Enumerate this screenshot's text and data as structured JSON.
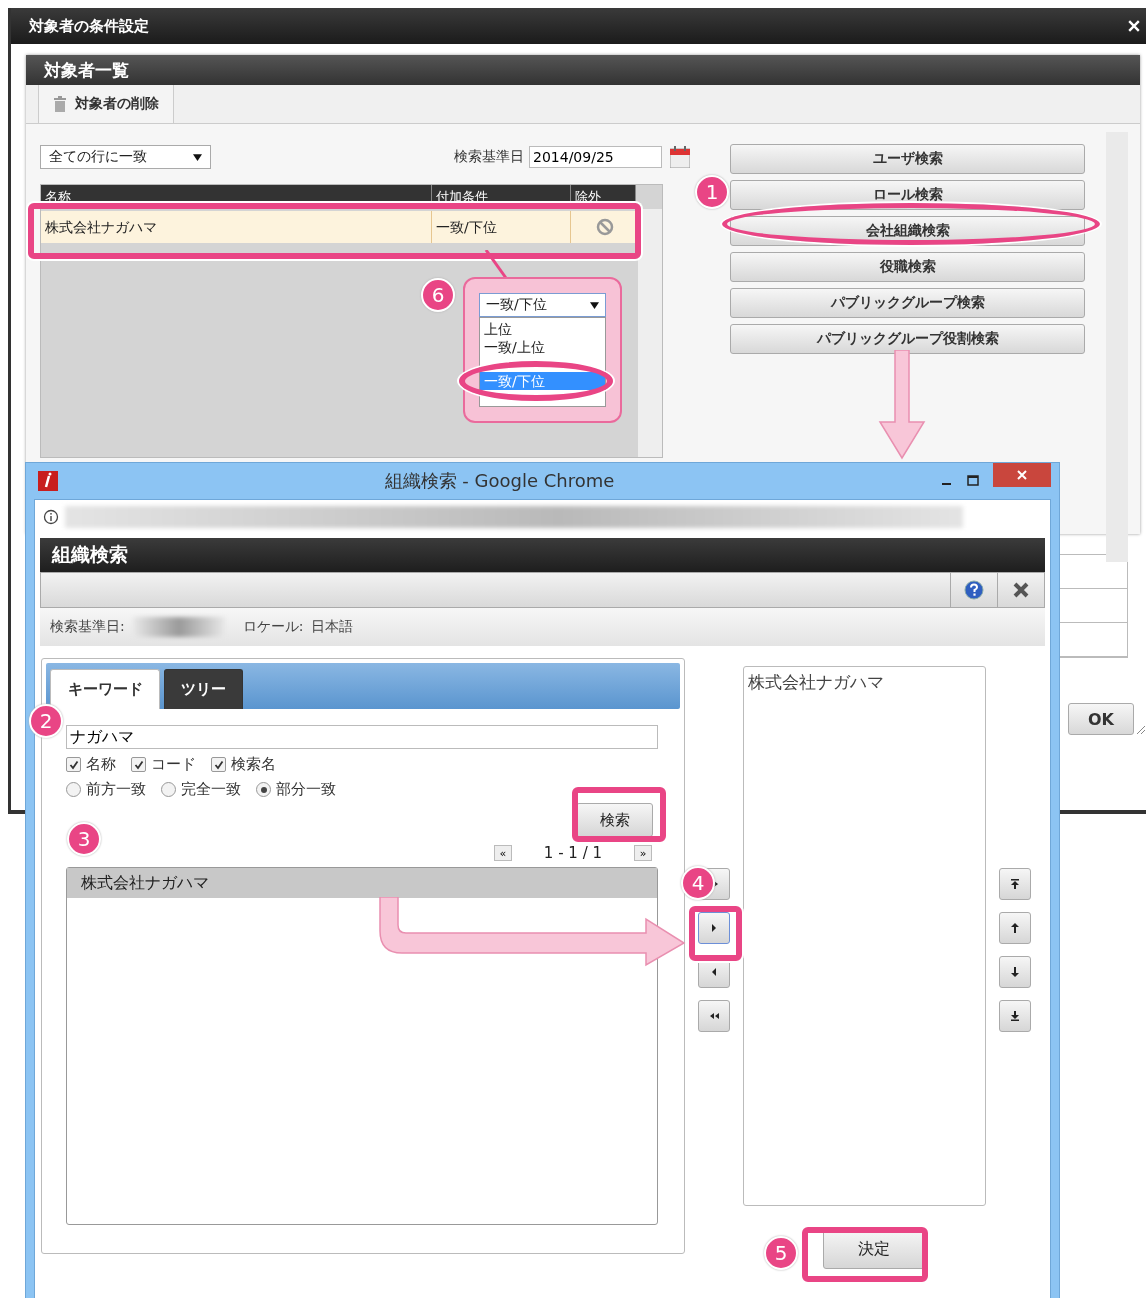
{
  "main_window": {
    "title": "対象者の条件設定",
    "panel": {
      "title": "対象者一覧",
      "toolbar": [
        {
          "label": "対象者の削除"
        }
      ],
      "match_select": "全ての行に一致",
      "date_label": "検索基準日",
      "date_value": "2014/09/25",
      "table": {
        "columns": [
          "名称",
          "付加条件",
          "除外"
        ],
        "rows": [
          {
            "name": "株式会社ナガハマ",
            "condition": "一致/下位"
          }
        ]
      },
      "condition_dropdown": {
        "value": "一致/下位",
        "options": [
          {
            "label": "上位",
            "selected": false
          },
          {
            "label": "一致/上位",
            "selected": false
          },
          {
            "label": "一致/下位",
            "selected": true
          }
        ]
      },
      "search_buttons": [
        "ユーザ検索",
        "ロール検索",
        "会社組織検索",
        "役職検索",
        "パブリックグループ検索",
        "パブリックグループ役割検索"
      ]
    },
    "ok_button": "OK"
  },
  "popup": {
    "window_title": "組織検索 - Google Chrome",
    "header": "組織検索",
    "date_label": "検索基準日:",
    "locale_label": "ロケール:",
    "locale_value": "日本語",
    "tabs": [
      {
        "label": "キーワード",
        "selected": true
      },
      {
        "label": "ツリー",
        "selected": false
      }
    ],
    "keyword": "ナガハマ",
    "fields": [
      {
        "label": "名称",
        "checked": true
      },
      {
        "label": "コード",
        "checked": true
      },
      {
        "label": "検索名",
        "checked": true
      }
    ],
    "match_modes": [
      {
        "label": "前方一致",
        "selected": false
      },
      {
        "label": "完全一致",
        "selected": false
      },
      {
        "label": "部分一致",
        "selected": true
      }
    ],
    "search_button": "検索",
    "pager": {
      "first": "«",
      "range": "1 - 1 / 1",
      "last": "»"
    },
    "results": [
      {
        "label": "株式会社ナガハマ",
        "selected": true
      }
    ],
    "selected_items": [
      "株式会社ナガハマ"
    ],
    "confirm_button": "決定"
  },
  "callouts": [
    "1",
    "2",
    "3",
    "4",
    "5",
    "6"
  ]
}
